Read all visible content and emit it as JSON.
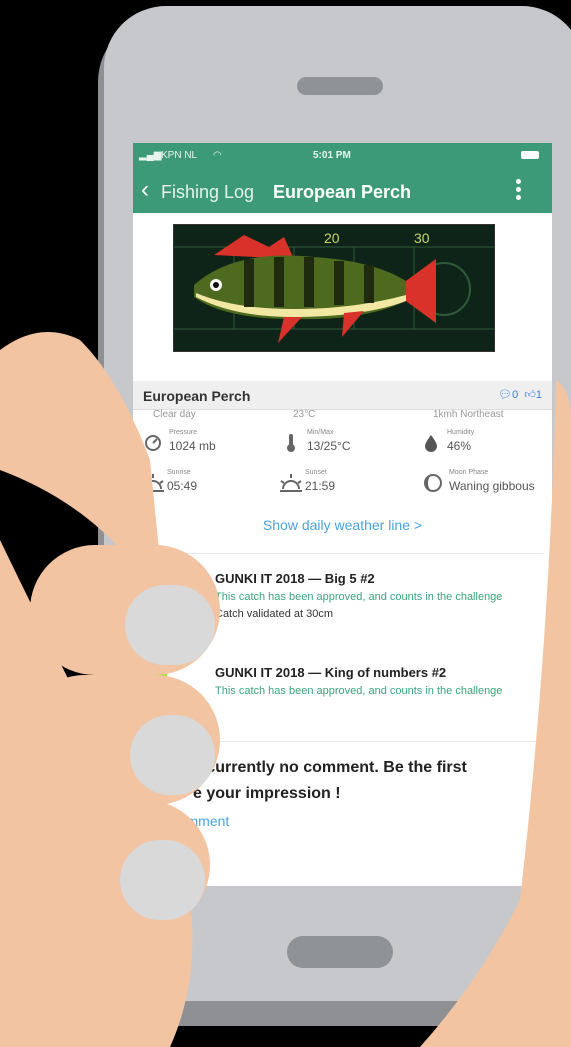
{
  "status_bar": {
    "carrier": "KPN NL",
    "time": "5:01 PM",
    "signal_icon": "signal-bars-icon",
    "wifi_icon": "wifi-icon",
    "battery_icon": "battery-icon"
  },
  "nav": {
    "back_icon": "chevron-left-icon",
    "back_label": "Fishing Log",
    "title": "European Perch",
    "menu_icon": "vertical-dots-icon"
  },
  "banner": {
    "label_left": "20",
    "label_right": "30"
  },
  "species": {
    "name": "European Perch",
    "comments_count": "0",
    "likes_count": "1",
    "comment_icon": "comment-bubble-icon",
    "like_icon": "thumbs-up-icon"
  },
  "weather": {
    "cut_row": [
      "Clear day",
      "23°C",
      "1kmh Northeast"
    ],
    "items": [
      {
        "icon": "pressure-gauge-icon",
        "label": "Pressure",
        "value": "1024 mb"
      },
      {
        "icon": "thermometer-icon",
        "label": "Min/Max",
        "value": "13/25°C"
      },
      {
        "icon": "humidity-drop-icon",
        "label": "Humidity",
        "value": "46%"
      },
      {
        "icon": "sunrise-icon",
        "label": "Sunrise",
        "value": "05:49"
      },
      {
        "icon": "sunset-icon",
        "label": "Sunset",
        "value": "21:59"
      },
      {
        "icon": "moon-phase-icon",
        "label": "Moon Phase",
        "value": "Waning gibbous"
      }
    ],
    "link": "Show daily weather line >"
  },
  "challenges": [
    {
      "title": "GUNKI IT 2018 — Big 5 #2",
      "status": "This catch has been approved, and counts in the challenge",
      "validation": "Catch validated at 30cm"
    },
    {
      "title": "GUNKI IT 2018 — King of numbers #2",
      "status": "This catch has been approved, and counts in the challenge"
    }
  ],
  "comments": {
    "empty_text_line1": "s currently no comment. Be the first",
    "empty_text_line2": "e your impression !",
    "comment_button": "Comment",
    "comment_icon": "pencil-icon"
  },
  "colors": {
    "header": "#3d9a78",
    "link": "#4aa3df",
    "approved": "#3ba37c",
    "badge": "#9be827"
  }
}
